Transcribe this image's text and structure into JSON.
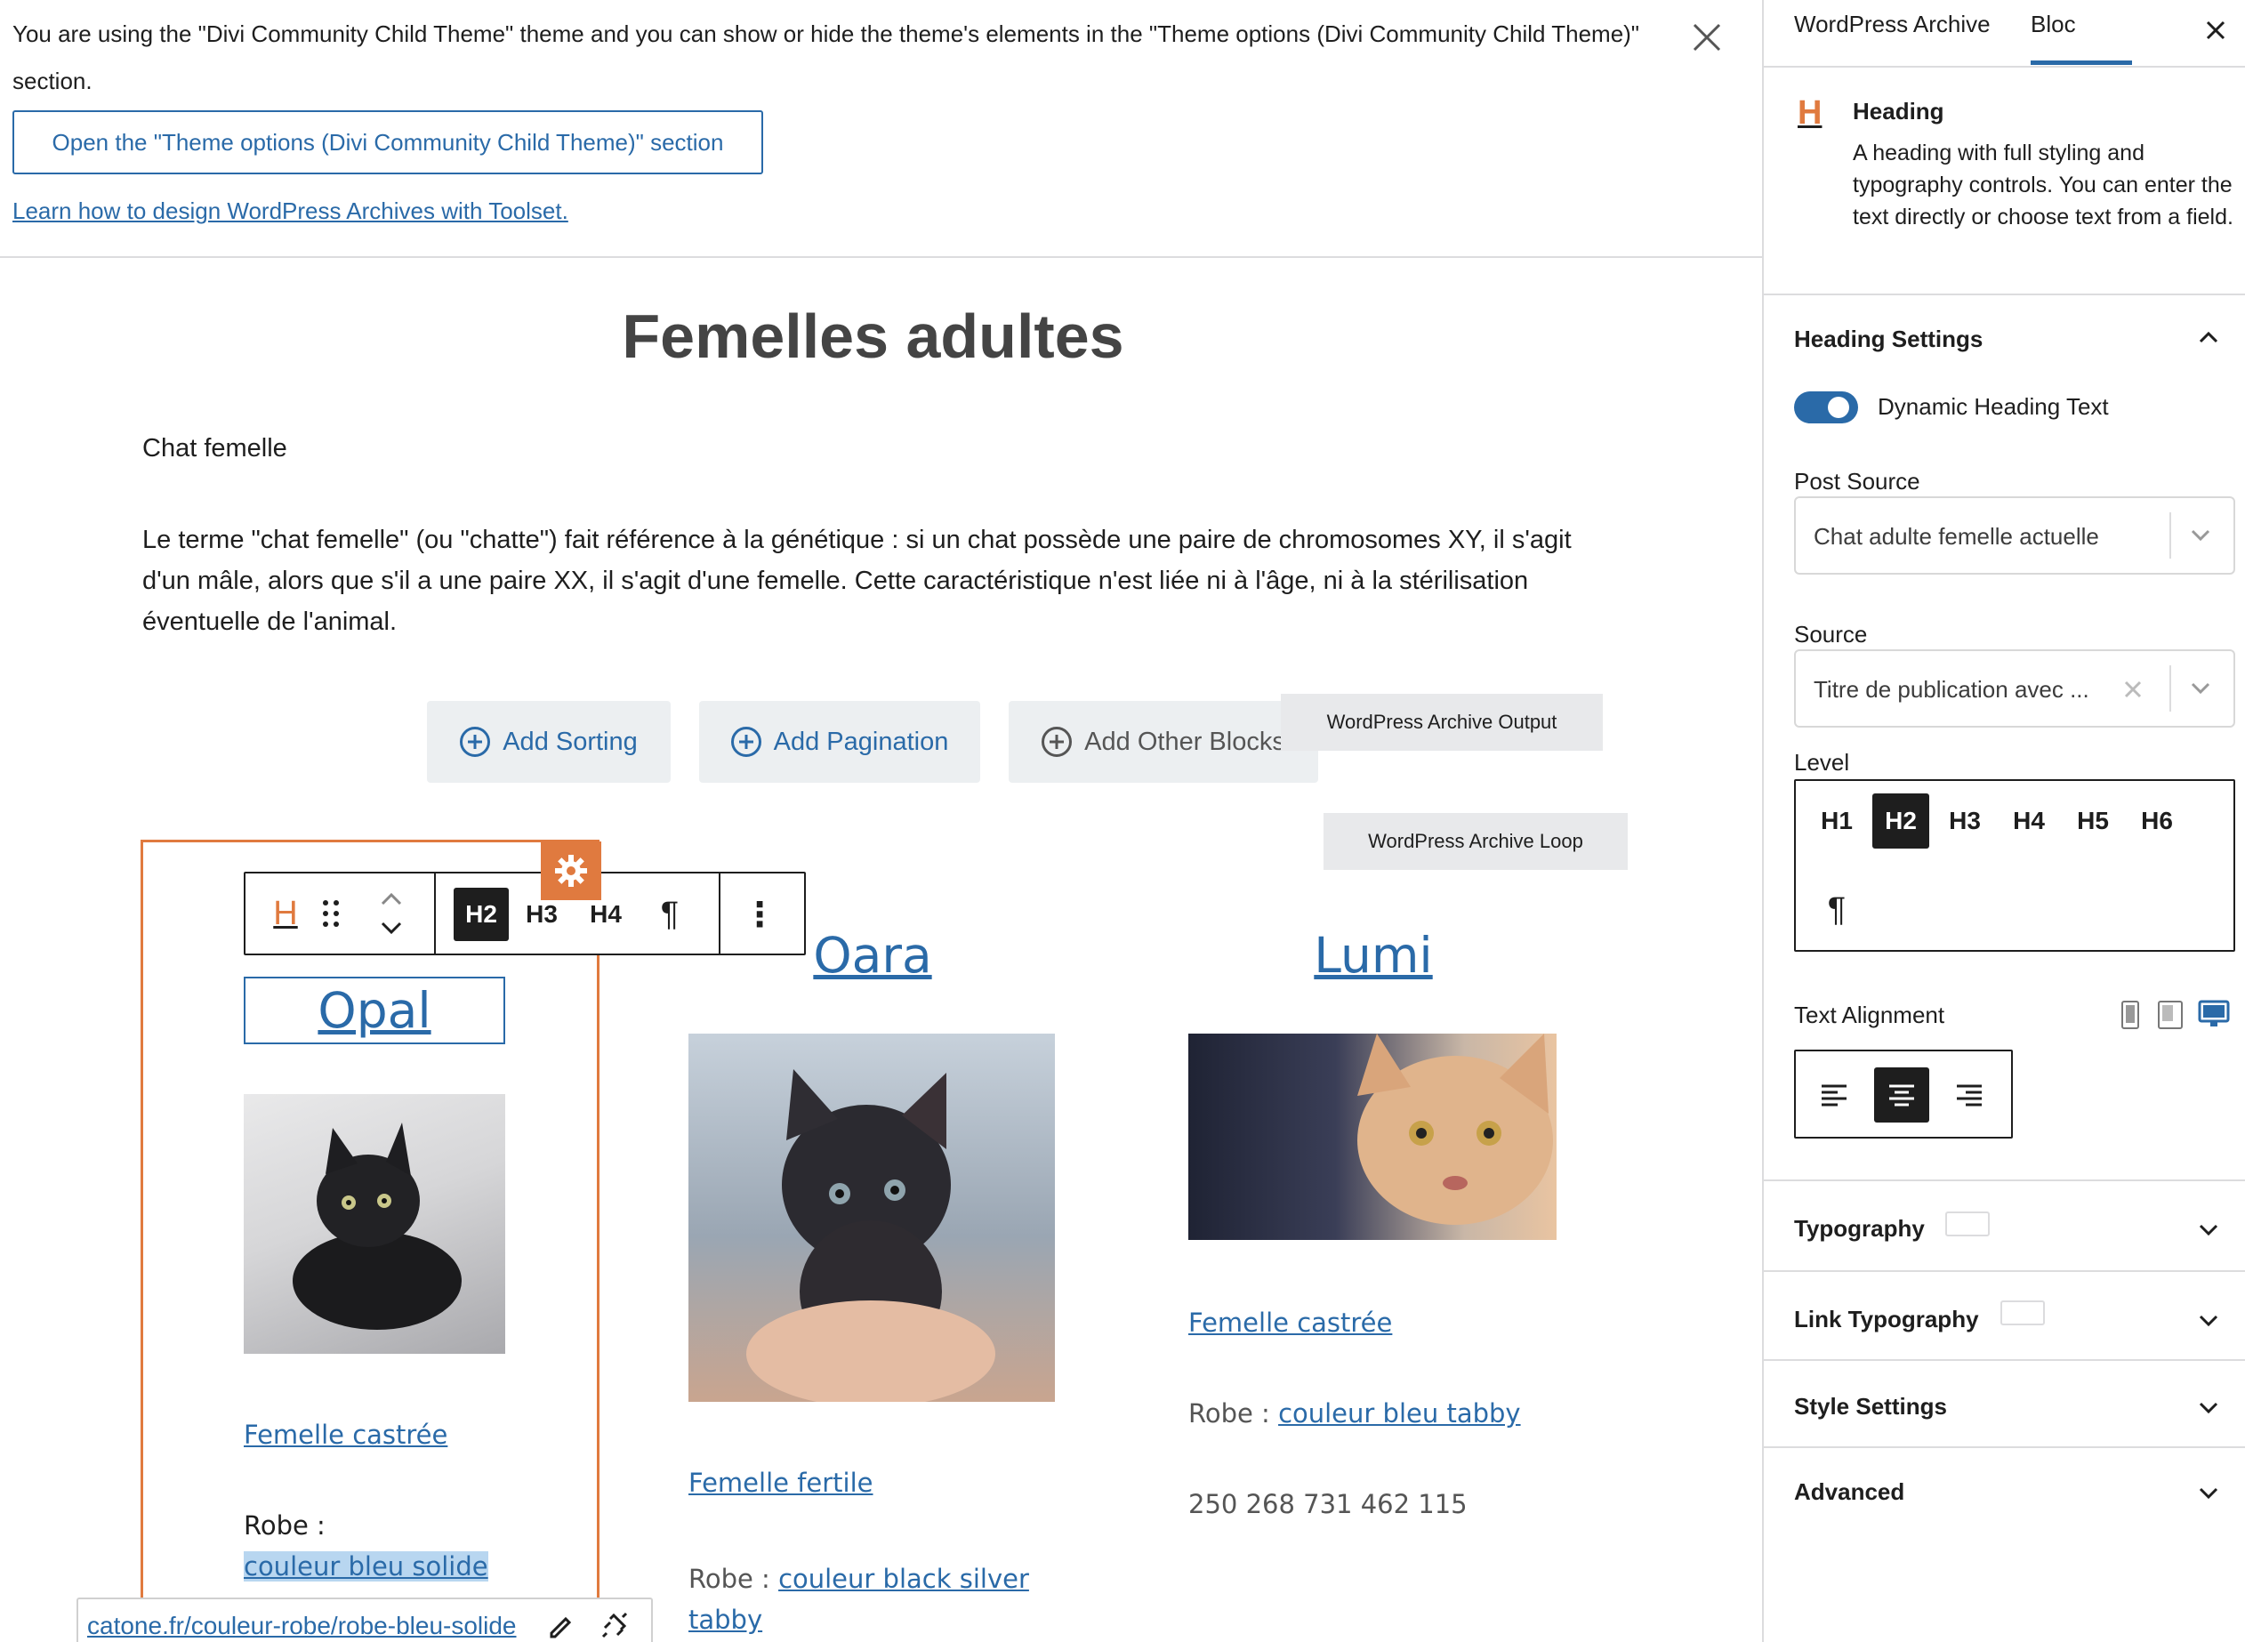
{
  "notice": {
    "text": "You are using the \"Divi Community Child Theme\" theme and you can show or hide the theme's elements in the \"Theme options (Divi Community Child Theme)\" section.",
    "button_label": "Open the \"Theme options (Divi Community Child Theme)\" section",
    "learn_link": "Learn how to design WordPress Archives with Toolset."
  },
  "content": {
    "title": "Femelles adultes",
    "intro_heading": "Chat femelle",
    "intro_paragraph": "Le terme \"chat femelle\" (ou \"chatte\") fait référence à la génétique : si un chat possède une paire de chromosomes XY, il s'agit d'un mâle, alors que s'il a une paire XX, il s'agit d'une femelle. Cette caractéristique n'est liée ni à l'âge, ni à la stérilisation éventuelle de l'animal.",
    "buttons": {
      "add_sorting": "Add Sorting",
      "add_pagination": "Add Pagination",
      "add_other_blocks": "Add Other Blocks"
    },
    "labels": {
      "archive_output": "WordPress Archive Output",
      "archive_loop": "WordPress Archive Loop"
    }
  },
  "toolbar": {
    "block_icon": "H",
    "levels": [
      "H2",
      "H3",
      "H4"
    ],
    "active_level": "H2",
    "paragraph_icon": "¶",
    "more_icon": "⋮"
  },
  "cards": [
    {
      "title": "Opal",
      "status": "Femelle castrée",
      "robe_label": "Robe :",
      "robe_link": "couleur bleu solide",
      "link_url": "catone.fr/couleur-robe/robe-bleu-solide"
    },
    {
      "title": "Oara",
      "status": "Femelle fertile",
      "robe_label": "Robe :",
      "robe_link": "couleur black silver tabby"
    },
    {
      "title": "Lumi",
      "status": "Femelle castrée",
      "robe_label": "Robe :",
      "robe_link": "couleur bleu tabby",
      "phone": "250 268 731 462 115"
    }
  ],
  "sidebar": {
    "tabs": [
      "WordPress Archive",
      "Bloc"
    ],
    "active_tab": "Bloc",
    "block_icon": "H",
    "block_name": "Heading",
    "block_description": "A heading with full styling and typography controls. You can enter the text directly or choose text from a field.",
    "heading_settings": "Heading Settings",
    "toggle_label": "Dynamic Heading Text",
    "toggle_on": true,
    "post_source_label": "Post Source",
    "post_source_value": "Chat adulte femelle actuelle",
    "source_label": "Source",
    "source_value": "Titre de publication avec ...",
    "level_label": "Level",
    "levels": [
      "H1",
      "H2",
      "H3",
      "H4",
      "H5",
      "H6"
    ],
    "active_level": "H2",
    "paragraph_icon": "¶",
    "text_alignment_label": "Text Alignment",
    "panels": [
      "Typography",
      "Link Typography",
      "Style Settings",
      "Advanced"
    ]
  },
  "colors": {
    "accent": "#2a6aa8",
    "block_highlight": "#e07a3f",
    "dark": "#1e1e1e"
  }
}
